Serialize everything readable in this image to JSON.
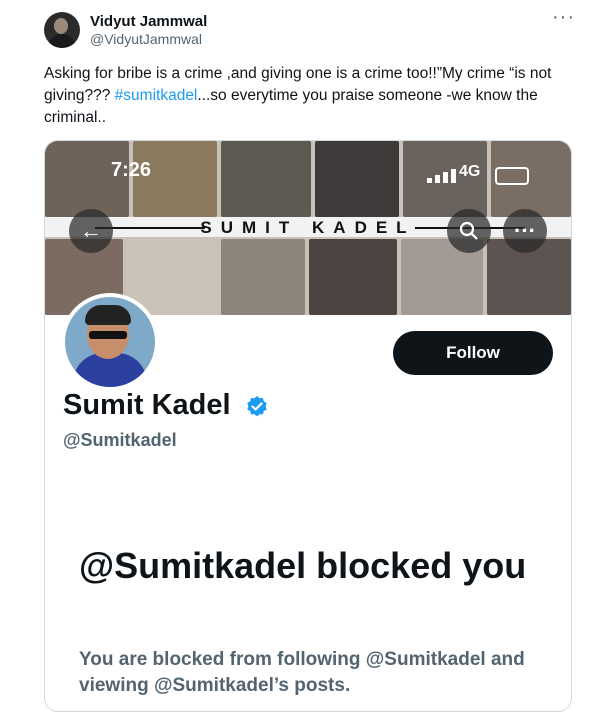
{
  "author": {
    "name": "Vidyut Jammwal",
    "handle": "@VidyutJammwal"
  },
  "more_label": "···",
  "tweet": {
    "text_before": "Asking for bribe is a crime ,and giving one is a crime too!!”My crime “is not giving??? ",
    "hashtag": "#sumitkadel",
    "text_after": "...so everytime you praise someone -we know the criminal.."
  },
  "screenshot": {
    "status_time": "7:26",
    "network": "4G",
    "banner_title": "SUMIT KADEL",
    "back_icon": "arrow-left-icon",
    "search_icon": "search-icon",
    "more_icon": "more-horizontal-icon",
    "profile": {
      "name": "Sumit Kadel",
      "handle": "@Sumitkadel",
      "follow_label": "Follow",
      "verified_color": "#1d9bf0"
    },
    "blocked": {
      "title": "@Sumitkadel blocked you",
      "subtitle": "You are blocked from following @Sumitkadel and viewing @Sumitkadel’s posts."
    }
  },
  "colors": {
    "accent": "#1d9bf0",
    "text_primary": "#0f1419",
    "text_secondary": "#536471"
  }
}
